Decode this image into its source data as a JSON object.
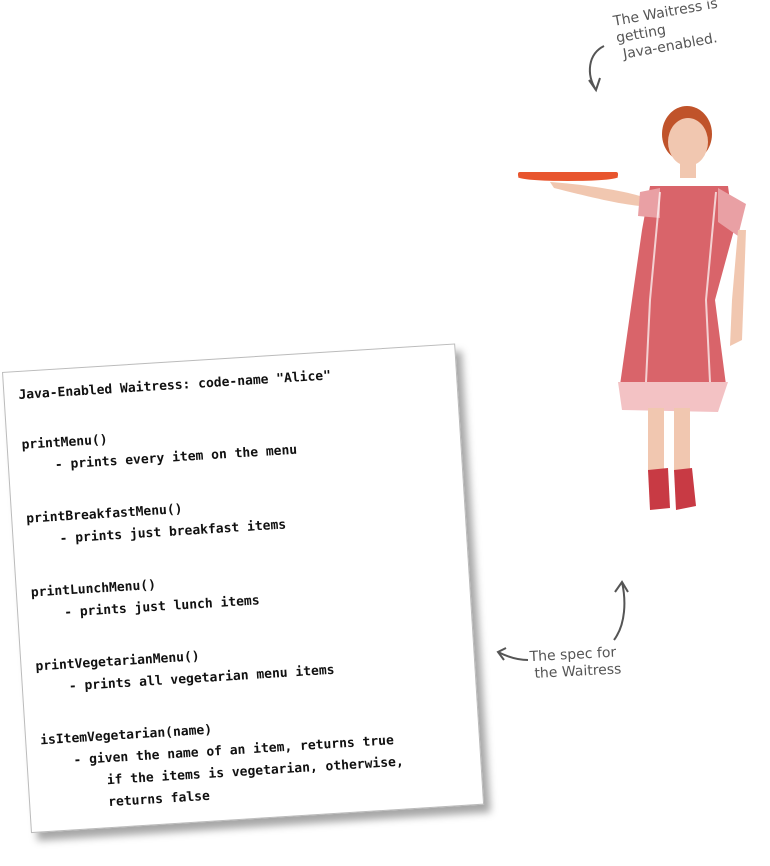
{
  "annotations": {
    "top_note": [
      "The Waitress is getting",
      "Java-enabled."
    ],
    "bottom_note": [
      "The spec for",
      "the Waitress"
    ]
  },
  "spec_card": {
    "title": "Java-Enabled Waitress: code-name \"Alice\"",
    "methods": [
      {
        "name": "printMenu()",
        "desc": [
          "- prints every item on the menu"
        ]
      },
      {
        "name": "printBreakfastMenu()",
        "desc": [
          "- prints just breakfast items"
        ]
      },
      {
        "name": "printLunchMenu()",
        "desc": [
          "- prints just lunch items"
        ]
      },
      {
        "name": "printVegetarianMenu()",
        "desc": [
          "- prints all vegetarian menu items"
        ]
      },
      {
        "name": "isItemVegetarian(name)",
        "desc": [
          "- given the name of an item, returns true",
          "if the items is vegetarian, otherwise,",
          "returns false"
        ]
      }
    ]
  },
  "colors": {
    "dress": "#d9646a",
    "tray": "#e8552e",
    "skin": "#f1c7b0",
    "hair": "#c0532a"
  }
}
